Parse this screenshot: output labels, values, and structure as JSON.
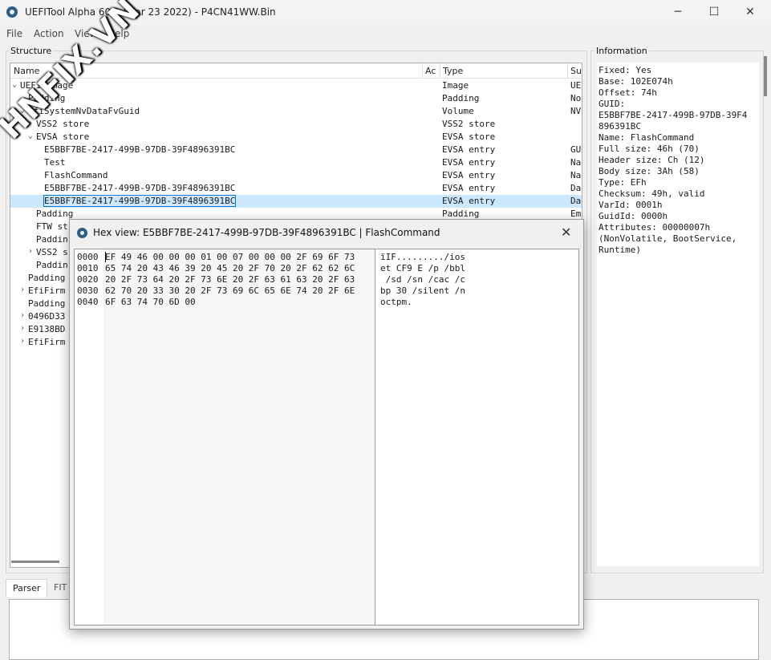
{
  "window": {
    "title": "UEFITool Alpha 60.1 (Mar 23 2022) - P4CN41WW.Bin",
    "minimize": "─",
    "maximize": "☐",
    "close": "✕"
  },
  "menu": [
    "File",
    "Action",
    "View",
    "Help"
  ],
  "structure": {
    "title": "Structure",
    "columns": [
      "Name",
      "Ac",
      "Type",
      "Su"
    ],
    "rows": [
      {
        "name": "UEFI image",
        "type": "Image",
        "sub": "UEI",
        "indent": 0,
        "expander": "open"
      },
      {
        "name": "Padding",
        "type": "Padding",
        "sub": "Nor",
        "indent": 1,
        "expander": ""
      },
      {
        "name": "EfiSystemNvDataFvGuid",
        "type": "Volume",
        "sub": "NV",
        "indent": 1,
        "expander": "open"
      },
      {
        "name": "VSS2 store",
        "type": "VSS2 store",
        "sub": "",
        "indent": 2,
        "expander": "closed"
      },
      {
        "name": "EVSA store",
        "type": "EVSA store",
        "sub": "",
        "indent": 2,
        "expander": "open"
      },
      {
        "name": "E5BBF7BE-2417-499B-97DB-39F4896391BC",
        "type": "EVSA entry",
        "sub": "GU",
        "indent": 3,
        "expander": ""
      },
      {
        "name": "Test",
        "type": "EVSA entry",
        "sub": "Na",
        "indent": 3,
        "expander": ""
      },
      {
        "name": "FlashCommand",
        "type": "EVSA entry",
        "sub": "Na",
        "indent": 3,
        "expander": ""
      },
      {
        "name": "E5BBF7BE-2417-499B-97DB-39F4896391BC",
        "type": "EVSA entry",
        "sub": "Da",
        "indent": 3,
        "expander": ""
      },
      {
        "name": "E5BBF7BE-2417-499B-97DB-39F4896391BC",
        "type": "EVSA entry",
        "sub": "Da",
        "indent": 3,
        "expander": "",
        "selected": true
      },
      {
        "name": "Padding",
        "type": "Padding",
        "sub": "Em",
        "indent": 2,
        "expander": ""
      },
      {
        "name": "FTW st",
        "type": "",
        "sub": "",
        "indent": 2,
        "expander": ""
      },
      {
        "name": "Paddin",
        "type": "",
        "sub": "",
        "indent": 2,
        "expander": ""
      },
      {
        "name": "VSS2 s",
        "type": "",
        "sub": "",
        "indent": 2,
        "expander": "closed"
      },
      {
        "name": "Paddin",
        "type": "",
        "sub": "",
        "indent": 2,
        "expander": ""
      },
      {
        "name": "Padding",
        "type": "",
        "sub": "",
        "indent": 1,
        "expander": ""
      },
      {
        "name": "EfiFirm",
        "type": "",
        "sub": "",
        "indent": 1,
        "expander": "closed"
      },
      {
        "name": "Padding",
        "type": "",
        "sub": "",
        "indent": 1,
        "expander": ""
      },
      {
        "name": "0496D33",
        "type": "",
        "sub": "",
        "indent": 1,
        "expander": "closed"
      },
      {
        "name": "E9138BD",
        "type": "",
        "sub": "",
        "indent": 1,
        "expander": "closed"
      },
      {
        "name": "EfiFirm",
        "type": "",
        "sub": "",
        "indent": 1,
        "expander": "closed"
      }
    ]
  },
  "information": {
    "title": "Information",
    "lines": [
      "Fixed: Yes",
      "Base: 102E074h",
      "Offset: 74h",
      "GUID:",
      "E5BBF7BE-2417-499B-97DB-39F4",
      "896391BC",
      "Name: FlashCommand",
      "Full size: 46h (70)",
      "Header size: Ch (12)",
      "Body size: 3Ah (58)",
      "Type: EFh",
      "Checksum: 49h, valid",
      "VarId: 0001h",
      "GuidId: 0000h",
      "Attributes: 00000007h",
      "(NonVolatile, BootService,",
      "Runtime)"
    ]
  },
  "bottom_tabs": [
    "Parser",
    "FIT"
  ],
  "hex_dialog": {
    "title": "Hex view: E5BBF7BE-2417-499B-97DB-39F4896391BC | FlashCommand",
    "close": "✕",
    "offsets": [
      "0000",
      "0010",
      "0020",
      "0030",
      "0040"
    ],
    "bytes": [
      "EF 49 46 00 00 00 01 00 07 00 00 00 2F 69 6F 73",
      "65 74 20 43 46 39 20 45 20 2F 70 20 2F 62 62 6C",
      "20 2F 73 64 20 2F 73 6E 20 2F 63 61 63 20 2F 63",
      "62 70 20 33 30 20 2F 73 69 6C 65 6E 74 20 2F 6E",
      "6F 63 74 70 6D 00"
    ],
    "ascii": [
      "ïIF........./ios",
      "et CF9 E /p /bbl",
      " /sd /sn /cac /c",
      "bp 30 /silent /n",
      "octpm."
    ]
  },
  "watermark": "HNFIX.VN"
}
